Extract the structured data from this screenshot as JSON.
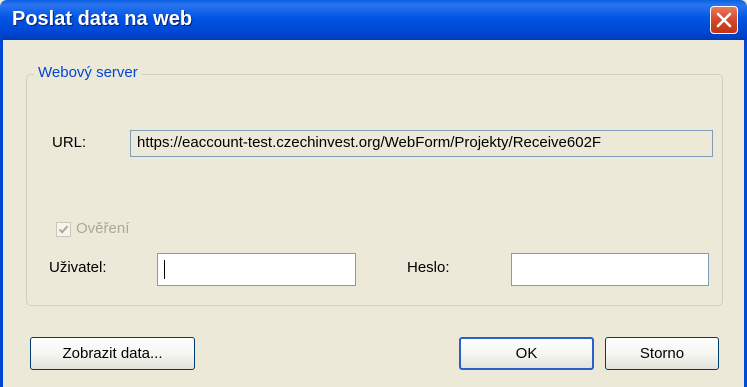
{
  "window": {
    "title": "Poslat data na web",
    "close_icon": "close-icon"
  },
  "group": {
    "title": "Webový server"
  },
  "url": {
    "label": "URL:",
    "value": "https://eaccount-test.czechinvest.org/WebForm/Projekty/Receive602F"
  },
  "auth": {
    "label": "Ověření",
    "checked": true,
    "enabled": false
  },
  "user": {
    "label": "Uživatel:",
    "value": ""
  },
  "password": {
    "label": "Heslo:",
    "value": ""
  },
  "buttons": {
    "show_data": "Zobrazit data...",
    "ok": "OK",
    "cancel": "Storno"
  },
  "colors": {
    "titlebar": "#0055e5",
    "dialog_bg": "#ece9d8",
    "group_title": "#0046d5",
    "close": "#d4482b"
  }
}
